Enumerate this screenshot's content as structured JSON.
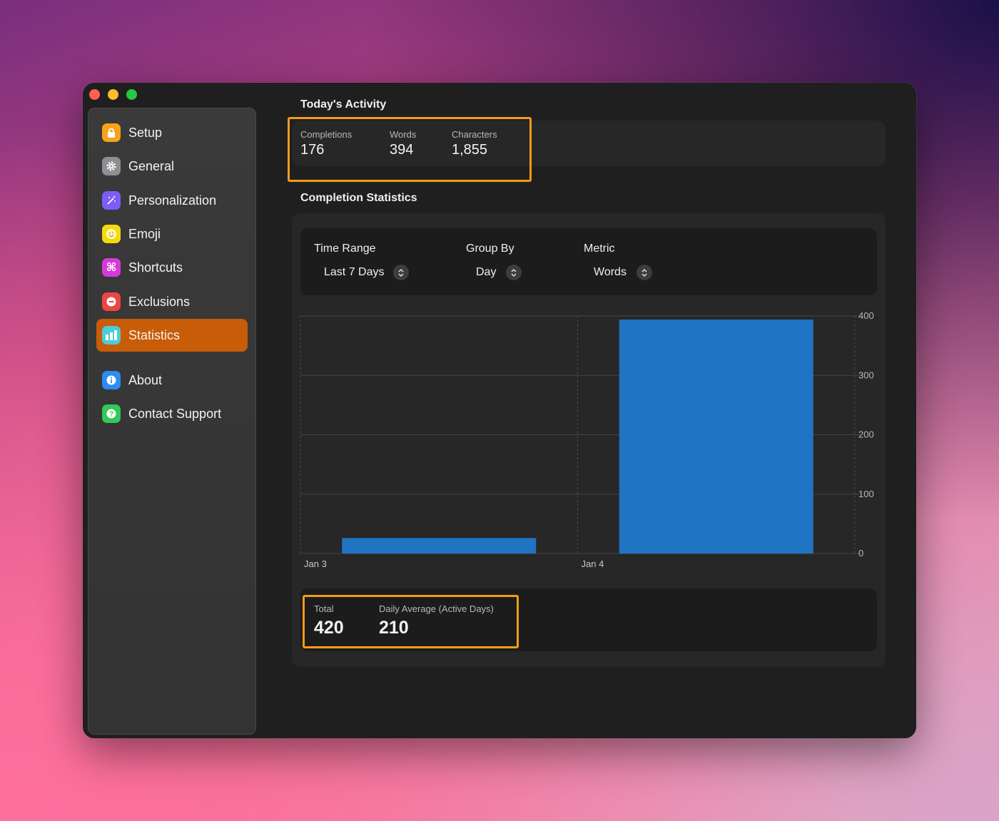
{
  "sidebar": {
    "items": [
      {
        "label": "Setup",
        "icon": "lock-icon",
        "color": "#f7a31a"
      },
      {
        "label": "General",
        "icon": "gear-icon",
        "color": "#8e8e93"
      },
      {
        "label": "Personalization",
        "icon": "magic-wand-icon",
        "color": "#7d5cf6"
      },
      {
        "label": "Emoji",
        "icon": "smiley-icon",
        "color": "#f5d90a"
      },
      {
        "label": "Shortcuts",
        "icon": "command-icon",
        "color": "#d63ad6"
      },
      {
        "label": "Exclusions",
        "icon": "minus-circle-icon",
        "color": "#ef4444"
      },
      {
        "label": "Statistics",
        "icon": "bar-chart-icon",
        "color": "#4ecbd9"
      },
      {
        "label": "About",
        "icon": "info-icon",
        "color": "#2d8cf0"
      },
      {
        "label": "Contact Support",
        "icon": "question-icon",
        "color": "#34c759"
      }
    ],
    "active": "Statistics",
    "accent": "#c85c08"
  },
  "today": {
    "title": "Today's Activity",
    "stats": [
      {
        "label": "Completions",
        "value": "176"
      },
      {
        "label": "Words",
        "value": "394"
      },
      {
        "label": "Characters",
        "value": "1,855"
      }
    ]
  },
  "completion": {
    "title": "Completion Statistics",
    "controls": [
      {
        "label": "Time Range",
        "value": "Last 7 Days"
      },
      {
        "label": "Group By",
        "value": "Day"
      },
      {
        "label": "Metric",
        "value": "Words"
      }
    ],
    "totals": [
      {
        "label": "Total",
        "value": "420"
      },
      {
        "label": "Daily Average (Active Days)",
        "value": "210"
      }
    ]
  },
  "chart_data": {
    "type": "bar",
    "categories": [
      "Jan 3",
      "Jan 4"
    ],
    "values": [
      26,
      394
    ],
    "ylim": [
      0,
      400
    ],
    "yticks": [
      0,
      100,
      200,
      300,
      400
    ],
    "y_axis_side": "right",
    "grid": true,
    "bar_color": "#1f74c4",
    "title": "",
    "xlabel": "",
    "ylabel": ""
  }
}
